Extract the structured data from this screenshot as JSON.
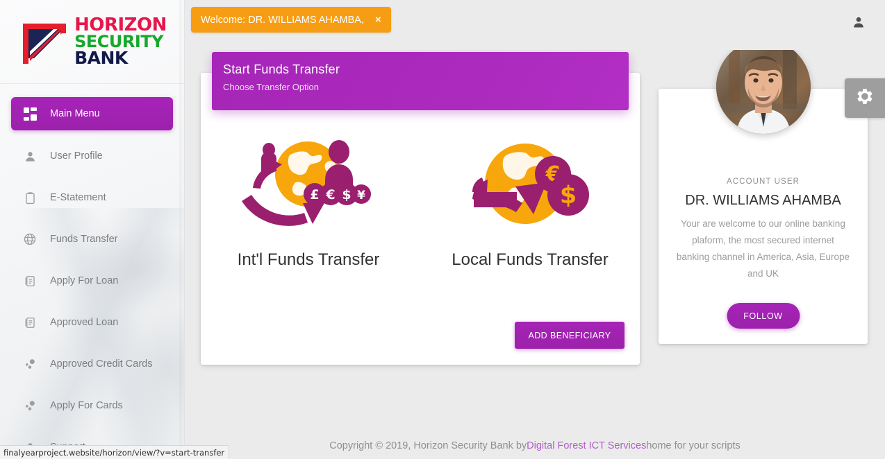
{
  "brand": {
    "line1": "HORIZON",
    "line2": "SECURITY",
    "line3": "BANK",
    "colors": {
      "line1": "#e5174b",
      "line2": "#17a82b",
      "line3": "#121a4a",
      "accent": "#a020b0",
      "alert": "#f79d14"
    }
  },
  "sidebar": {
    "items": [
      {
        "label": "Main Menu",
        "icon": "grid-icon",
        "active": true
      },
      {
        "label": "User Profile",
        "icon": "user-icon",
        "active": false
      },
      {
        "label": "E-Statement",
        "icon": "clipboard-icon",
        "active": false
      },
      {
        "label": "Funds Transfer",
        "icon": "globe-icon",
        "active": false
      },
      {
        "label": "Apply For Loan",
        "icon": "document-icon",
        "active": false
      },
      {
        "label": "Approved Loan",
        "icon": "document-icon",
        "active": false
      },
      {
        "label": "Approved Credit Cards",
        "icon": "nodes-icon",
        "active": false
      },
      {
        "label": "Apply For Cards",
        "icon": "nodes-icon",
        "active": false
      },
      {
        "label": "Support",
        "icon": "support-icon",
        "active": false
      }
    ]
  },
  "topbar": {
    "welcome_text": "Welcome: DR. WILLIAMS AHAMBA,",
    "close_label": "×",
    "user_icon": "user-icon"
  },
  "transfer": {
    "header_title": "Start Funds Transfer",
    "header_subtitle": "Choose Transfer Option",
    "options": [
      {
        "label": "Int'l Funds Transfer",
        "icon": "international-transfer-icon",
        "currencies": [
          "£",
          "€",
          "$",
          "¥"
        ]
      },
      {
        "label": "Local Funds Transfer",
        "icon": "local-transfer-icon",
        "currencies": [
          "€",
          "$"
        ]
      }
    ],
    "add_beneficiary_label": "ADD BENEFICIARY"
  },
  "profile": {
    "role": "ACCOUNT USER",
    "name": "DR. WILLIAMS AHAMBA",
    "description": "Your are welcome to our online banking plaform, the most secured internet banking channel in America, Asia, Europe and UK",
    "follow_label": "FOLLOW",
    "avatar_icon": "user-photo"
  },
  "settings": {
    "icon": "gear-icon"
  },
  "footer": {
    "prefix": "Copyright © 2019, Horizon Security Bank by ",
    "link": "Digital Forest ICT Services",
    "suffix": " home for your scripts"
  },
  "status_bar": {
    "url": "finalyearproject.website/horizon/view/?v=start-transfer"
  }
}
